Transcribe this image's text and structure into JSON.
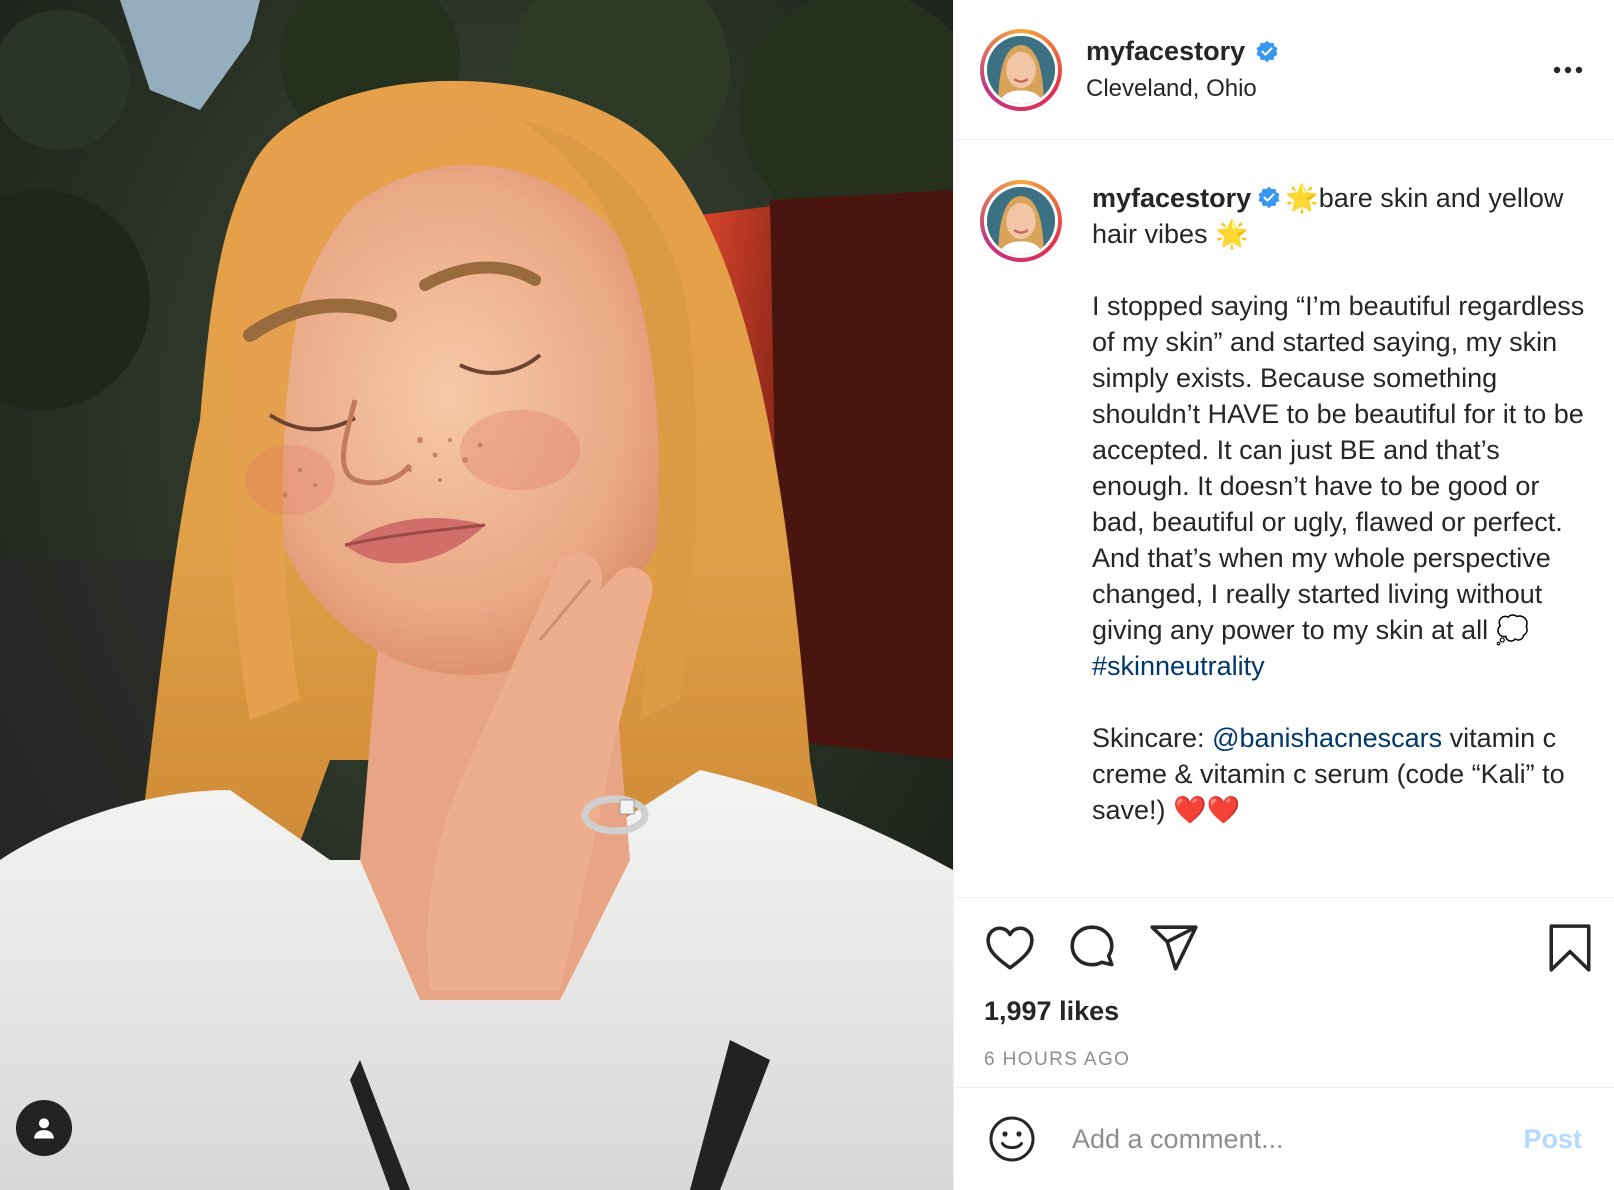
{
  "post": {
    "username": "myfacestory",
    "location": "Cleveland, Ohio",
    "verified": true,
    "caption": {
      "username": "myfacestory",
      "title_star_before": "🌟",
      "title_text": "bare skin and yellow hair vibes",
      "title_star_after": "🌟",
      "body": "I stopped saying “I’m beautiful regardless of my skin” and started saying, my skin simply exists. Because something shouldn’t HAVE to be beautiful for it to be accepted. It can just BE and that’s enough. It doesn’t have to be good or bad, beautiful or ugly, flawed or perfect. And that’s when my whole perspective changed, I really started living without giving any power to my skin at all",
      "body_emoji": "💭",
      "hashtag": "#skinneutrality",
      "skincare_prefix": "Skincare:",
      "mention": "@banishacnescars",
      "skincare_suffix": "vitamin c creme & vitamin c serum (code “Kali” to save!)",
      "hearts": "❤️❤️"
    },
    "likes": "1,997 likes",
    "timestamp": "6 HOURS AGO",
    "comment": {
      "placeholder": "Add a comment...",
      "post_label": "Post"
    }
  },
  "icons": {
    "like": "heart-icon",
    "comment": "comment-icon",
    "share": "share-icon",
    "save": "bookmark-icon",
    "more": "more-icon",
    "emoji": "emoji-icon",
    "tag": "user-tag-icon",
    "verified": "verified-badge-icon"
  },
  "colors": {
    "link": "#00376b",
    "verified": "#3897f0",
    "post_disabled": "#b3dbff",
    "muted": "#8e8e8e",
    "text": "#262626"
  }
}
